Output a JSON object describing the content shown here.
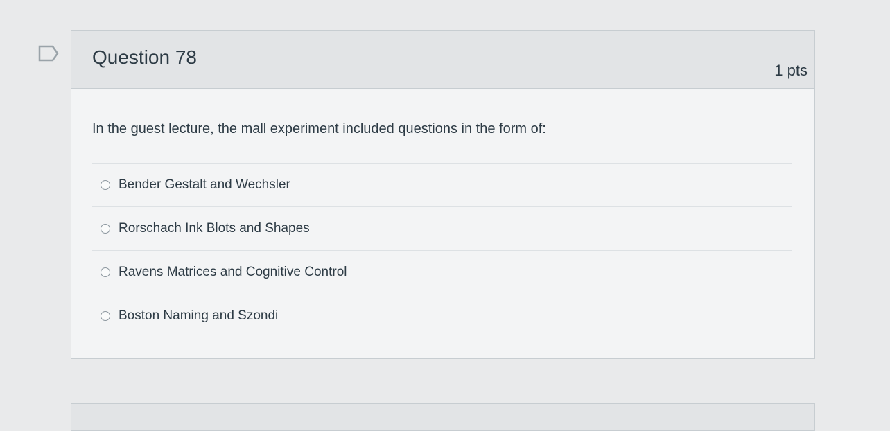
{
  "question": {
    "title": "Question 78",
    "points": "1 pts",
    "text": "In the guest lecture, the mall experiment included questions in the form of:",
    "answers": [
      {
        "label": "Bender Gestalt and Wechsler"
      },
      {
        "label": "Rorschach Ink Blots and Shapes"
      },
      {
        "label": "Ravens Matrices and Cognitive Control"
      },
      {
        "label": "Boston Naming and Szondi"
      }
    ]
  },
  "colors": {
    "text": "#2d3b45",
    "header_bg": "#e2e4e6",
    "card_bg": "#f3f4f5",
    "border": "#c7cdd1"
  }
}
